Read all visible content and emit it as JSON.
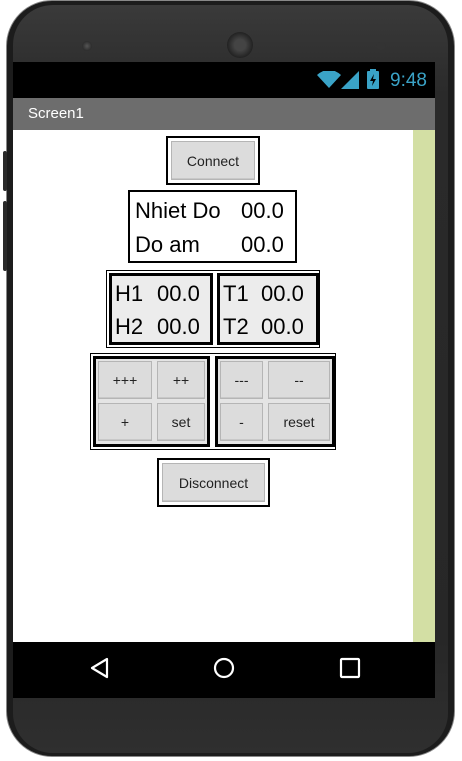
{
  "status_bar": {
    "time": "9:48",
    "icons": [
      "wifi-icon",
      "signal-icon",
      "battery-icon"
    ]
  },
  "app": {
    "title": "Screen1"
  },
  "connect_button": "Connect",
  "sensor": {
    "temperature_label": "Nhiet Do",
    "temperature_value": "00.0",
    "humidity_label": "Do am",
    "humidity_value": "00.0"
  },
  "thresholds": {
    "h1_label": "H1",
    "h1_value": "00.0",
    "h2_label": "H2",
    "h2_value": "00.0",
    "t1_label": "T1",
    "t1_value": "00.0",
    "t2_label": "T2",
    "t2_value": "00.0"
  },
  "controls": {
    "plus3": "+++",
    "plus2": "++",
    "plus1": "+",
    "set": "set",
    "minus3": "---",
    "minus2": "--",
    "minus1": "-",
    "reset": "reset"
  },
  "disconnect_button": "Disconnect",
  "nav": {
    "icons": [
      "back-icon",
      "home-icon",
      "recents-icon"
    ]
  },
  "colors": {
    "clock": "#3aa3c7",
    "title_bar": "#6d6d6d",
    "scroll_strip": "#d3dfa4",
    "button": "#dcdcdc"
  }
}
